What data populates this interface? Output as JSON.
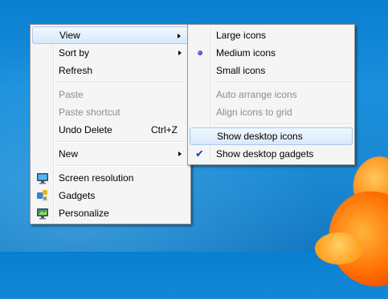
{
  "main_menu": {
    "items": [
      {
        "label": "View",
        "has_submenu": true,
        "state": "highlighted"
      },
      {
        "label": "Sort by",
        "has_submenu": true
      },
      {
        "label": "Refresh"
      },
      {
        "label": "Paste",
        "disabled": true
      },
      {
        "label": "Paste shortcut",
        "disabled": true
      },
      {
        "label": "Undo Delete",
        "shortcut": "Ctrl+Z"
      },
      {
        "label": "New",
        "has_submenu": true
      },
      {
        "label": "Screen resolution",
        "icon": "monitor-icon"
      },
      {
        "label": "Gadgets",
        "icon": "gadgets-icon"
      },
      {
        "label": "Personalize",
        "icon": "personalize-icon"
      }
    ]
  },
  "view_submenu": {
    "items": [
      {
        "label": "Large icons"
      },
      {
        "label": "Medium icons",
        "radio_selected": true
      },
      {
        "label": "Small icons"
      },
      {
        "label": "Auto arrange icons",
        "disabled": true
      },
      {
        "label": "Align icons to grid",
        "disabled": true
      },
      {
        "label": "Show desktop icons",
        "state": "hovered"
      },
      {
        "label": "Show desktop gadgets",
        "checked": true
      }
    ]
  },
  "colors": {
    "desktop": "#1a8fdc",
    "menu_bg": "#f5f5f5",
    "highlight_border": "#a9c7ea",
    "disabled_text": "#8d8d8d"
  }
}
